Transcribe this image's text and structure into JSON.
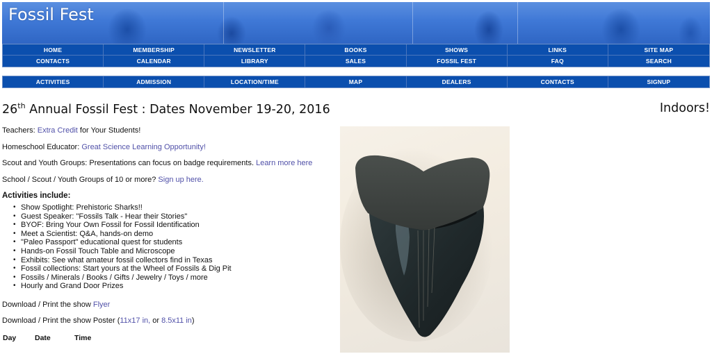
{
  "banner": {
    "site_title": "Fossil Fest",
    "image_description": "blue-tinted photo collage of students examining fossils"
  },
  "main_nav": {
    "row1": [
      "HOME",
      "MEMBERSHIP",
      "NEWSLETTER",
      "BOOKS",
      "SHOWS",
      "LINKS",
      "SITE MAP"
    ],
    "row2": [
      "CONTACTS",
      "CALENDAR",
      "LIBRARY",
      "SALES",
      "FOSSIL FEST",
      "FAQ",
      "SEARCH"
    ]
  },
  "sub_nav": [
    "ACTIVITIES",
    "ADMISSION",
    "LOCATION/TIME",
    "MAP",
    "DEALERS",
    "CONTACTS",
    "SIGNUP"
  ],
  "headline": {
    "ordinal_number": "26",
    "ordinal_suffix": "th",
    "text": " Annual Fossil Fest : Dates November 19-20, 2016",
    "right_note": "Indoors!"
  },
  "intro": [
    {
      "prefix": "Teachers: ",
      "link": "Extra Credit",
      "suffix": " for Your Students!"
    },
    {
      "prefix": "Homeschool Educator: ",
      "link": "Great Science Learning Opportunity!",
      "suffix": ""
    },
    {
      "prefix": "Scout and Youth Groups: Presentations can focus on badge requirements. ",
      "link": "Learn more here",
      "suffix": ""
    },
    {
      "prefix": "School / Scout / Youth Groups of 10 or more? ",
      "link": "Sign up here.",
      "suffix": ""
    }
  ],
  "activities": {
    "title": "Activities include:",
    "items": [
      "Show Spotlight: Prehistoric Sharks!!",
      "Guest Speaker: \"Fossils Talk - Hear their Stories\"",
      "BYOF: Bring Your Own Fossil for Fossil Identification",
      "Meet a Scientist: Q&A, hands-on demo",
      "\"Paleo Passport\" educational quest for students",
      "Hands-on Fossil Touch Table and Microscope",
      "Exhibits: See what amateur fossil collectors find in Texas",
      "Fossil collections: Start yours at the Wheel of Fossils & Dig Pit",
      "Fossils / Minerals / Books / Gifts / Jewelry / Toys / more",
      "Hourly and Grand Door Prizes"
    ]
  },
  "downloads": {
    "flyer_prefix": "Download / Print the show ",
    "flyer_link": "Flyer",
    "poster_prefix": "Download / Print the show Poster (",
    "poster_link1": "11x17 in,",
    "poster_mid": " or ",
    "poster_link2": "8.5x11 in",
    "poster_suffix": ")"
  },
  "schedule": {
    "headers": [
      "Day",
      "Date",
      "Time"
    ]
  },
  "photo": {
    "alt": "Megalodon shark tooth fossil"
  },
  "colors": {
    "nav_bg": "#0b4fae",
    "link": "#5050a8",
    "banner": "#3f78d6"
  }
}
